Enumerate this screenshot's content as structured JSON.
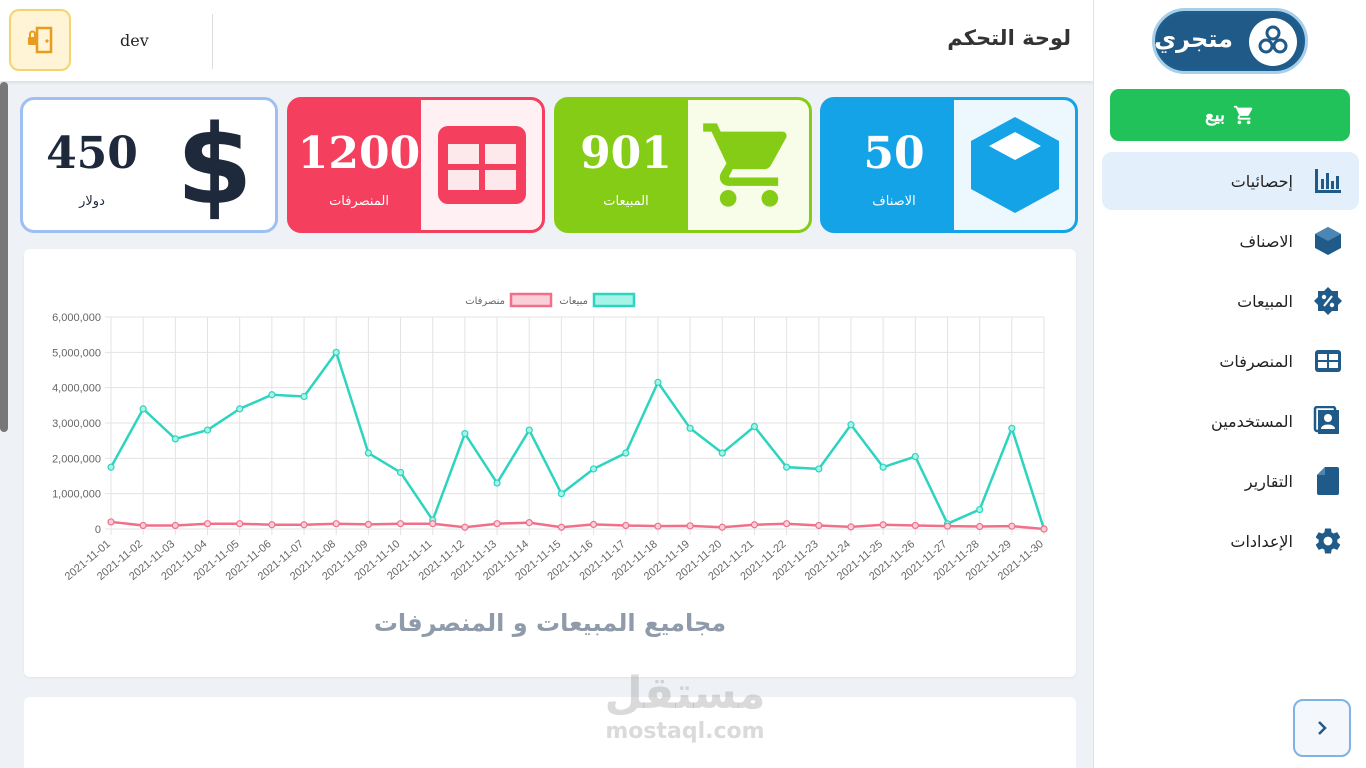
{
  "header": {
    "title": "لوحة التحكم",
    "user": "dev"
  },
  "sidebar": {
    "logo_text": "متجري",
    "sell_label": "بيع",
    "items": [
      {
        "label": "إحصائيات",
        "icon": "bar-chart-icon",
        "active": true
      },
      {
        "label": "الاصناف",
        "icon": "cube-icon",
        "active": false
      },
      {
        "label": "المبيعات",
        "icon": "sales-badge-icon",
        "active": false
      },
      {
        "label": "المنصرفات",
        "icon": "table-icon",
        "active": false
      },
      {
        "label": "المستخدمين",
        "icon": "contacts-icon",
        "active": false
      },
      {
        "label": "التقارير",
        "icon": "file-icon",
        "active": false
      },
      {
        "label": "الإعدادات",
        "icon": "gear-icon",
        "active": false
      }
    ]
  },
  "cards": [
    {
      "value": "50",
      "label": "الاصناف",
      "icon": "cube-icon",
      "color": "#14a3e7"
    },
    {
      "value": "901",
      "label": "المبيعات",
      "icon": "cart-icon",
      "color": "#85cc16"
    },
    {
      "value": "1200",
      "label": "المنصرفات",
      "icon": "table-icon",
      "color": "#f43f5e"
    },
    {
      "value": "450",
      "label": "دولار",
      "icon": "dollar-icon",
      "color": "#1e293b"
    }
  ],
  "chart_data": {
    "type": "line",
    "title": "مجاميع المبيعات و المنصرفات",
    "legend_position": "top",
    "grid": true,
    "ylim": [
      0,
      6000000
    ],
    "yticks": [
      "0",
      "1,000,000",
      "2,000,000",
      "3,000,000",
      "4,000,000",
      "5,000,000",
      "6,000,000"
    ],
    "categories": [
      "2021-11-01",
      "2021-11-02",
      "2021-11-03",
      "2021-11-04",
      "2021-11-05",
      "2021-11-06",
      "2021-11-07",
      "2021-11-08",
      "2021-11-09",
      "2021-11-10",
      "2021-11-11",
      "2021-11-12",
      "2021-11-13",
      "2021-11-14",
      "2021-11-15",
      "2021-11-16",
      "2021-11-17",
      "2021-11-18",
      "2021-11-19",
      "2021-11-20",
      "2021-11-21",
      "2021-11-22",
      "2021-11-23",
      "2021-11-24",
      "2021-11-25",
      "2021-11-26",
      "2021-11-27",
      "2021-11-28",
      "2021-11-29",
      "2021-11-30"
    ],
    "series": [
      {
        "name": "مبيعات",
        "color": "#2dd4bf",
        "fill": "#a7f3e8",
        "values": [
          1750000,
          3400000,
          2550000,
          2800000,
          3400000,
          3800000,
          3750000,
          5000000,
          2150000,
          1600000,
          250000,
          2700000,
          1300000,
          2800000,
          1000000,
          1700000,
          2150000,
          4150000,
          2850000,
          2150000,
          2900000,
          1750000,
          1700000,
          2950000,
          1750000,
          2050000,
          150000,
          550000,
          2850000,
          0
        ]
      },
      {
        "name": "منصرفات",
        "color": "#f0708a",
        "fill": "#fbcfd8",
        "values": [
          200000,
          100000,
          100000,
          150000,
          150000,
          120000,
          120000,
          150000,
          130000,
          150000,
          150000,
          50000,
          150000,
          180000,
          50000,
          130000,
          100000,
          80000,
          90000,
          50000,
          120000,
          150000,
          100000,
          60000,
          120000,
          100000,
          80000,
          70000,
          80000,
          0
        ]
      }
    ]
  },
  "watermark": {
    "ar": "مستقل",
    "en": "mostaql.com"
  }
}
